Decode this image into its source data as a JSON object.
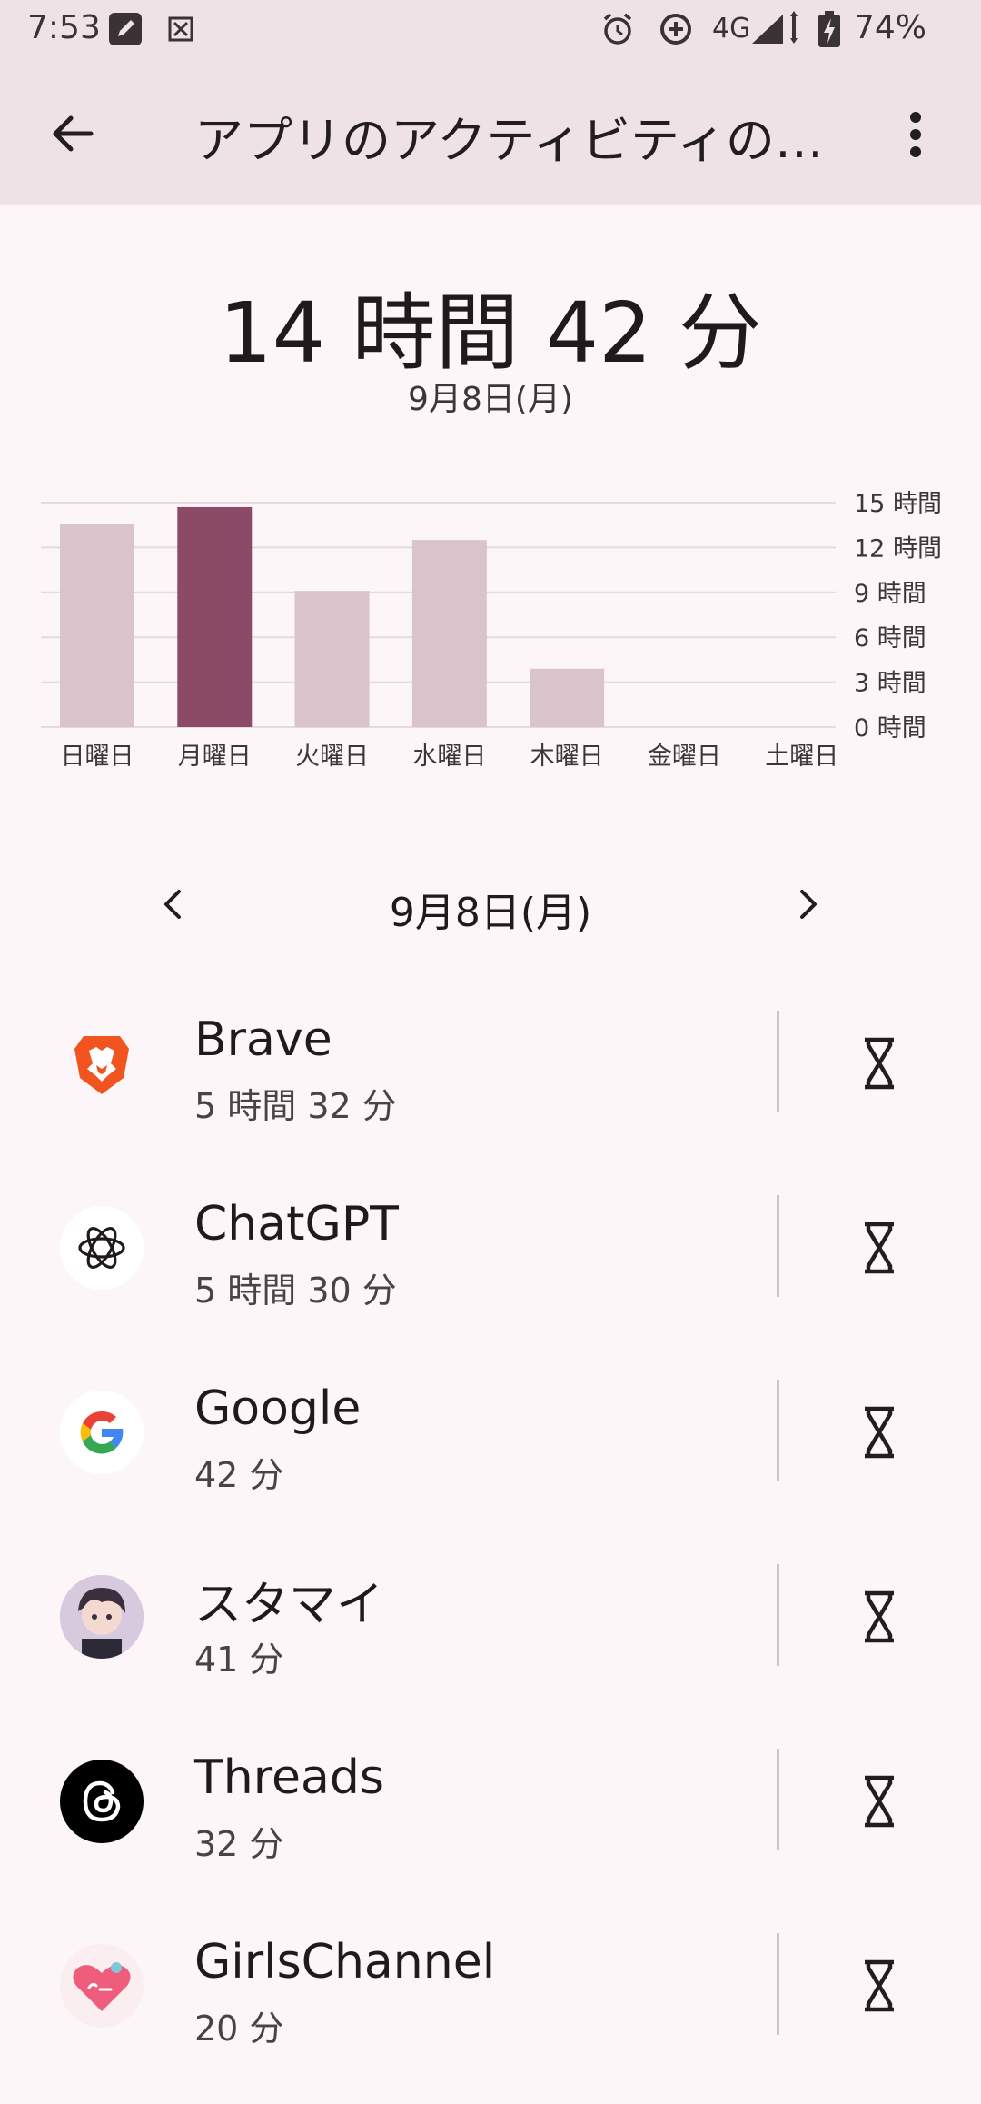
{
  "status_bar": {
    "time": "7:53",
    "network": "4G",
    "battery": "74%"
  },
  "app_bar": {
    "title": "アプリのアクティビティの…"
  },
  "summary": {
    "total": "14 時間 42 分",
    "date": "9月8日(月)"
  },
  "chart_data": {
    "type": "bar",
    "categories": [
      "日曜日",
      "月曜日",
      "火曜日",
      "水曜日",
      "木曜日",
      "金曜日",
      "土曜日"
    ],
    "values": [
      13.6,
      14.7,
      9.1,
      12.5,
      3.9,
      0,
      0
    ],
    "selected_index": 1,
    "ylim": [
      0,
      15
    ],
    "yticks": [
      "15 時間",
      "12 時間",
      "9 時間",
      "6 時間",
      "3 時間",
      "0 時間"
    ],
    "ytick_values": [
      15,
      12,
      9,
      6,
      3,
      0
    ],
    "colors": {
      "bar": "#d9c4cb",
      "selected": "#8b4a66",
      "grid": "#e6dadd"
    }
  },
  "date_nav": {
    "label": "9月8日(月)"
  },
  "apps": [
    {
      "name": "Brave",
      "usage": "5 時間 32 分",
      "icon": "brave-icon"
    },
    {
      "name": "ChatGPT",
      "usage": "5 時間 30 分",
      "icon": "chatgpt-icon"
    },
    {
      "name": "Google",
      "usage": "42 分",
      "icon": "google-icon"
    },
    {
      "name": "スタマイ",
      "usage": "41 分",
      "icon": "stamai-icon"
    },
    {
      "name": "Threads",
      "usage": "32 分",
      "icon": "threads-icon"
    },
    {
      "name": "GirlsChannel",
      "usage": "20 分",
      "icon": "girlschannel-icon"
    }
  ]
}
